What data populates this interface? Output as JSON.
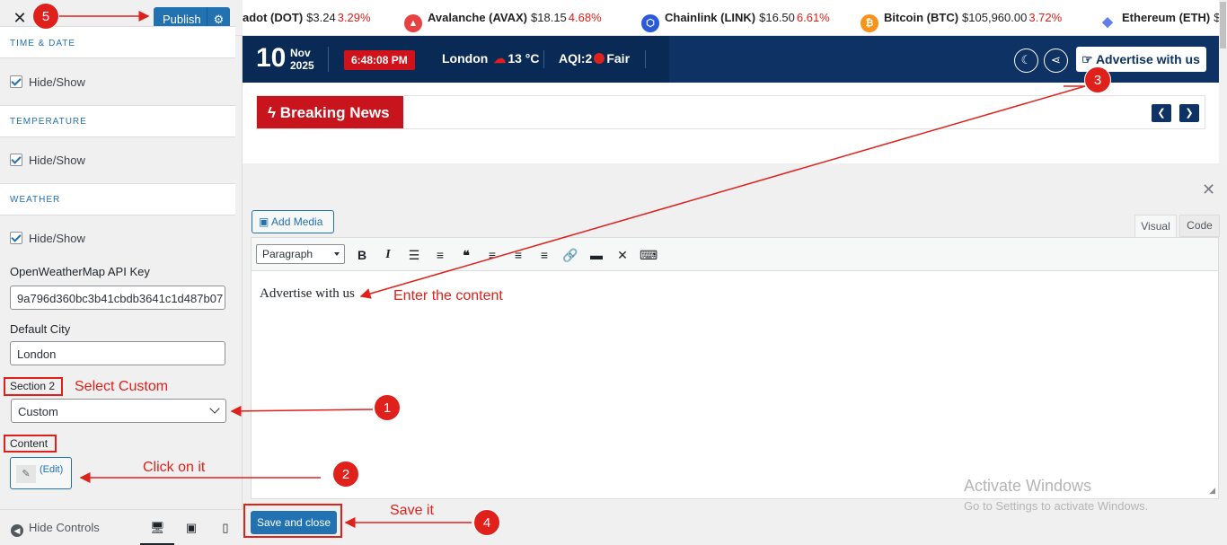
{
  "customizer": {
    "close_icon": "close-icon",
    "publish_label": "Publish",
    "gear_icon": "gear-icon",
    "sections": [
      {
        "title": "TIME & DATE",
        "checkbox_label": "Hide/Show"
      },
      {
        "title": "TEMPERATURE",
        "checkbox_label": "Hide/Show"
      },
      {
        "title": "WEATHER",
        "checkbox_label": "Hide/Show"
      }
    ],
    "api_key_label": "OpenWeatherMap API Key",
    "api_key_value": "9a796d360bc3b41cbdb3641c1d487b07",
    "default_city_label": "Default City",
    "default_city_value": "London",
    "section2_label": "Section 2",
    "section2_value": "Custom",
    "content_label": "Content",
    "edit_label": "(Edit)",
    "hide_controls": "Hide Controls"
  },
  "ticker": [
    {
      "name": "adot (DOT)",
      "price": "$3.24",
      "change": "3.29%",
      "icon": "polkadot-icon",
      "color": "#e6007a"
    },
    {
      "name": "Avalanche (AVAX)",
      "price": "$18.15",
      "change": "4.68%",
      "icon": "avalanche-icon",
      "color": "#e84142"
    },
    {
      "name": "Chainlink (LINK)",
      "price": "$16.50",
      "change": "6.61%",
      "icon": "chainlink-icon",
      "color": "#2a5ada"
    },
    {
      "name": "Bitcoin (BTC)",
      "price": "$105,960.00",
      "change": "3.72%",
      "icon": "bitcoin-icon",
      "color": "#f7931a"
    },
    {
      "name": "Ethereum (ETH)",
      "price": "$",
      "change": "",
      "icon": "ethereum-icon",
      "color": "#627eea"
    }
  ],
  "header": {
    "day": "10",
    "month": "Nov",
    "year": "2025",
    "time": "6:48:08 PM",
    "city": "London",
    "temp": "13 °C",
    "aqi": "AQI:2",
    "aqi_status": "Fair",
    "advertise": "Advertise with us"
  },
  "breaking": {
    "label": "Breaking News"
  },
  "editor": {
    "add_media": "Add Media",
    "tab_visual": "Visual",
    "tab_code": "Code",
    "format": "Paragraph",
    "content": "Advertise with us",
    "save_close": "Save and close"
  },
  "annotations": {
    "n1": "1",
    "n2": "2",
    "n3": "3",
    "n4": "4",
    "n5": "5",
    "select_custom": "Select Custom",
    "click_on_it": "Click on it",
    "enter_content": "Enter the content",
    "save_it": "Save it"
  },
  "watermark": {
    "line1": "Activate Windows",
    "line2": "Go to Settings to activate Windows."
  },
  "colors": {
    "accent": "#2271b1",
    "navy": "#0d3263",
    "breaking_red": "#c8141c",
    "annotation_red": "#e0201b"
  }
}
